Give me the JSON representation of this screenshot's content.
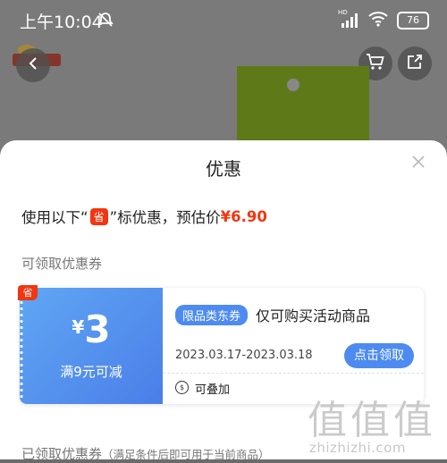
{
  "status_bar": {
    "time": "上午10:04",
    "network": "HD",
    "battery": "76"
  },
  "sheet": {
    "title": "优惠",
    "price_prefix": "使用以下“",
    "price_badge": "省",
    "price_middle": "”标优惠，预估价",
    "price_value": "¥6.90",
    "available_label": "可领取优惠券",
    "claimed_label": "已领取优惠券",
    "claimed_sub": "（满足条件后即可用于当前商品）"
  },
  "coupon": {
    "corner_badge": "省",
    "currency": "¥",
    "amount": "3",
    "condition": "满9元可减",
    "tag": "限品类东券",
    "description": "仅可购买活动商品",
    "date_range": "2023.03.17-2023.03.18",
    "claim_label": "点击领取",
    "stack_icon_glyph": "$",
    "stack_label": "可叠加"
  },
  "watermark": {
    "glyph": "值",
    "url": "zhizhizhi.com"
  },
  "colors": {
    "accent_red": "#f2360f",
    "coupon_blue": "#4d8bf0"
  },
  "icons": [
    "back-icon",
    "cart-icon",
    "share-icon",
    "close-icon",
    "mute-icon",
    "signal-icon",
    "wifi-icon"
  ]
}
